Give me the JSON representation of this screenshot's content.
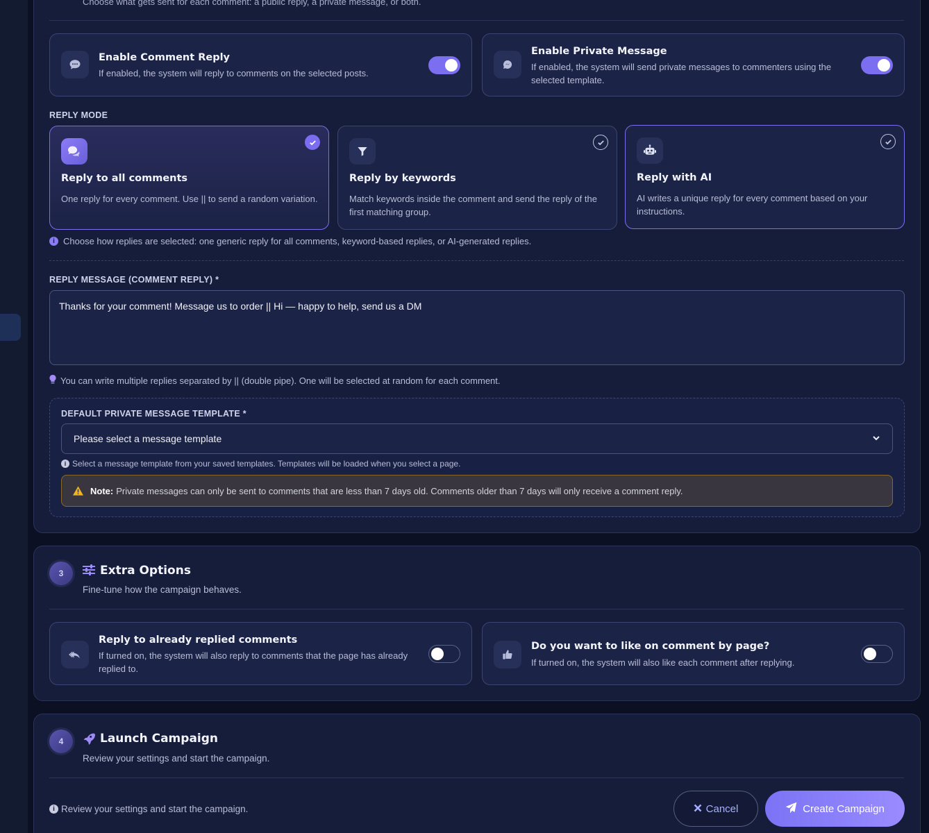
{
  "top_hint": "Choose what gets sent for each comment: a public reply, a private message, or both.",
  "send_options": [
    {
      "icon": "chat-bubble-icon",
      "title": "Enable Comment Reply",
      "desc": "If enabled, the system will reply to comments on the selected posts.",
      "enabled": true
    },
    {
      "icon": "message-icon",
      "title": "Enable Private Message",
      "desc": "If enabled, the system will send private messages to commenters using the selected template.",
      "enabled": true
    }
  ],
  "reply_mode": {
    "label": "REPLY MODE",
    "options": [
      {
        "icon": "comments-icon",
        "title": "Reply to all comments",
        "desc": "One reply for every comment. Use || to send a random variation.",
        "selected": true
      },
      {
        "icon": "filter-icon",
        "title": "Reply by keywords",
        "desc": "Match keywords inside the comment and send the reply of the first matching group.",
        "selected": false
      },
      {
        "icon": "robot-icon",
        "title": "Reply with AI",
        "desc": "AI writes a unique reply for every comment based on your instructions.",
        "selected": false
      }
    ],
    "hint": "Choose how replies are selected: one generic reply for all comments, keyword-based replies, or AI-generated replies."
  },
  "reply_message": {
    "label": "REPLY MESSAGE (COMMENT REPLY) *",
    "value": "Thanks for your comment! Message us to order || Hi — happy to help, send us a DM",
    "hint": "You can write multiple replies separated by || (double pipe). One will be selected at random for each comment."
  },
  "template": {
    "label": "DEFAULT PRIVATE MESSAGE TEMPLATE *",
    "selected": "Please select a message template",
    "hint": "Select a message template from your saved templates. Templates will be loaded when you select a page.",
    "note_label": "Note:",
    "note_text": "Private messages can only be sent to comments that are less than 7 days old. Comments older than 7 days will only receive a comment reply."
  },
  "extra": {
    "step": "3",
    "title": "Extra Options",
    "subtitle": "Fine-tune how the campaign behaves.",
    "options": [
      {
        "icon": "reply-all-icon",
        "title": "Reply to already replied comments",
        "desc": "If turned on, the system will also reply to comments that the page has already replied to.",
        "enabled": false
      },
      {
        "icon": "thumbs-up-icon",
        "title": "Do you want to like on comment by page?",
        "desc": "If turned on, the system will also like each comment after replying.",
        "enabled": false
      }
    ]
  },
  "launch": {
    "step": "4",
    "title": "Launch Campaign",
    "subtitle": "Review your settings and start the campaign.",
    "footer_hint": "Review your settings and start the campaign.",
    "cancel_label": "Cancel",
    "create_label": "Create Campaign"
  },
  "colors": {
    "accent": "#7b6ef0",
    "background": "#0b1122",
    "panel": "#161d3a",
    "warning": "#f0b429"
  }
}
